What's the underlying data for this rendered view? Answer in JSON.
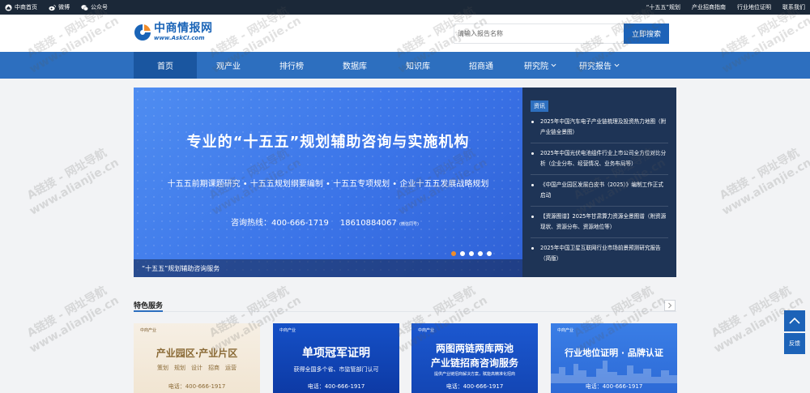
{
  "topbar": {
    "left": [
      {
        "label": "中商首页",
        "icon": "home-icon"
      },
      {
        "label": "微博",
        "icon": "weibo-icon"
      },
      {
        "label": "公众号",
        "icon": "wechat-icon"
      }
    ],
    "right": [
      "“十五五”规划",
      "产业招商指南",
      "行业地位证明",
      "联系我们"
    ]
  },
  "logo": {
    "cn": "中商情报网",
    "en": "www.AskCI.com"
  },
  "search": {
    "placeholder": "请输入报告名称",
    "button": "立即搜索"
  },
  "nav": {
    "items": [
      {
        "label": "首页",
        "active": true,
        "dropdown": false
      },
      {
        "label": "观产业",
        "active": false,
        "dropdown": false
      },
      {
        "label": "排行榜",
        "active": false,
        "dropdown": false
      },
      {
        "label": "数据库",
        "active": false,
        "dropdown": false
      },
      {
        "label": "知识库",
        "active": false,
        "dropdown": false
      },
      {
        "label": "招商通",
        "active": false,
        "dropdown": false
      },
      {
        "label": "研究院",
        "active": false,
        "dropdown": true
      },
      {
        "label": "研究报告",
        "active": false,
        "dropdown": true
      }
    ]
  },
  "banner": {
    "title": "专业的“十五五”规划辅助咨询与实施机构",
    "subtitle": "十五五前期课题研究 • 十五五规划纲要编制 • 十五五专项规划 • 企业十五五发展战略规划",
    "hotline_label": "咨询热线：400-666-1719",
    "mobile": "18610884067",
    "mobile_note": "(微信同号)",
    "caption": "“十五五”规划辅助咨询服务",
    "slide_count": 5,
    "active_slide": 1
  },
  "news": {
    "tag": "资讯",
    "items": [
      "2025年中国汽车电子产业链梳理及投资热力地图（附产业链全景图）",
      "2025年中国光伏电池组件行业上市公司全方位对比分析（企业分布、经营情况、业务布局等）",
      "《中国产业园区发展白皮书（2025）》编制工作正式启动",
      "【资源图谱】2025年甘肃算力资源全景图谱（附资源现状、资源分布、资源地位等）",
      "2025年中国卫星互联网行业市场前景预测研究报告（简版）"
    ]
  },
  "features": {
    "title": "特色服务",
    "cards": [
      {
        "brand": "中商产业",
        "title": "产业园区·产业片区",
        "sub": "策划　规划　设计　招商　运营",
        "phone": "电话：400-666-1917"
      },
      {
        "brand": "中商产业",
        "title": "单项冠军证明",
        "sub": "获得全国多个省、市监管部门认可",
        "phone": "电话：400-666-1917"
      },
      {
        "brand": "中商产业",
        "title": "两图两链两库两池",
        "title2": "产业链招商咨询服务",
        "sub": "提供产业链招商解决方案，赋能高精准化招商",
        "phone": "电话：400-666-1917"
      },
      {
        "brand": "中商产业",
        "title": "行业地位证明 · 品牌认证",
        "sub": "",
        "phone": "电话：400-666-1917"
      }
    ]
  },
  "side": {
    "feedback": "反馈"
  },
  "watermark": {
    "line1": "A链接 - 网址导航",
    "line2": "www.alianjie.cn"
  },
  "colors": {
    "nav": "#2d6fbf",
    "nav_active": "#1a56a0",
    "topbar": "#1b2838",
    "news_bg": "#1e3456",
    "accent_dot": "#f08c2a"
  }
}
